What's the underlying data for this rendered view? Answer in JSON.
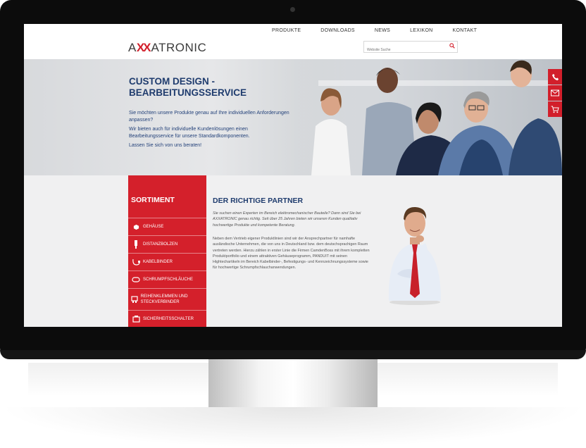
{
  "site": {
    "logo_prefix": "A",
    "logo_x": "XX",
    "logo_suffix": "ATRONIC",
    "search_placeholder": "Website Suche"
  },
  "nav": [
    "PRODUKTE",
    "DOWNLOADS",
    "NEWS",
    "LEXIKON",
    "KONTAKT"
  ],
  "hero": {
    "title_line1": "CUSTOM DESIGN -",
    "title_line2": "BEARBEITUNGSSERVICE",
    "p1": "Sie möchten unsere Produkte genau auf Ihre individuellen Anforderungen anpassen?",
    "p2": "Wir bieten auch für individuelle Kundenlösungen einen Bearbeitungsservice für unsere Standardkomponenten.",
    "p3": "Lassen Sie sich von uns beraten!"
  },
  "sortiment": {
    "title": "SORTIMENT",
    "items": [
      "GEHÄUSE",
      "DISTANZBOLZEN",
      "KABELBINDER",
      "SCHRUMPFSCHLÄUCHE",
      "REIHENKLEMMEN UND STECKVERBINDER",
      "SICHERHEITSSCHALTER"
    ]
  },
  "partner": {
    "title": "DER RICHTIGE PARTNER",
    "intro": "Sie suchen einen Experten im Bereich elektromechanischer Bauteile? Dann sind Sie bei AXXATRONIC genau richtig. Seit über 25 Jahren bieten wir unseren Kunden qualitativ hochwertige Produkte und kompetente Beratung.",
    "body": "Neben dem Vertrieb eigener Produktlinien sind wir der Ansprechpartner für namhafte ausländische Unternehmen, die von uns in Deutschland bzw. dem deutschsprachigen Raum vertreten werden. Hierzu zählen in erster Linie die Firmen CamdenBoss mit ihrem kompletten Produktportfolio und einem attraktiven Gehäuseprogramm, PANDUIT mit seinen Hightechartikeln im Bereich Kabelbinder-, Befestigungs- und Kennzeichnungssysteme sowie für hochwertige Schrumpfschlauchanwendungen."
  },
  "colors": {
    "brand_red": "#d21f2b",
    "navy": "#1f3c6e"
  }
}
